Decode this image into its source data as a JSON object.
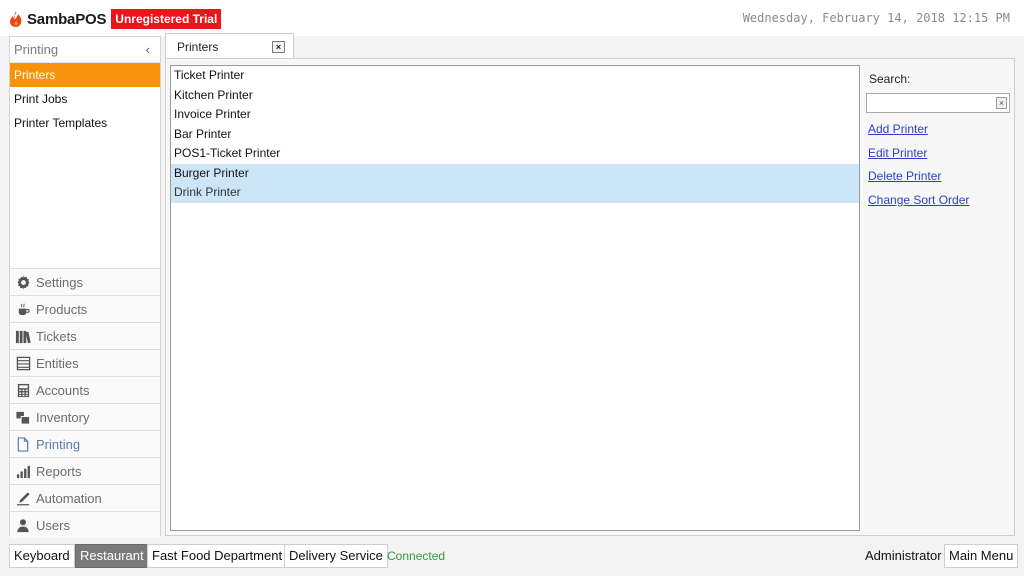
{
  "header": {
    "app_name": "SambaPOS",
    "trial_badge": "Unregistered Trial",
    "datetime": "Wednesday, February 14, 2018 12:15 PM"
  },
  "sidebar": {
    "section_title": "Printing",
    "collapse_glyph": "‹",
    "sub_items": [
      {
        "label": "Printers",
        "active": true
      },
      {
        "label": "Print Jobs",
        "active": false
      },
      {
        "label": "Printer Templates",
        "active": false
      }
    ],
    "nav_items": [
      {
        "label": "Settings",
        "icon": "gear-icon"
      },
      {
        "label": "Products",
        "icon": "coffee-cup-icon"
      },
      {
        "label": "Tickets",
        "icon": "books-icon"
      },
      {
        "label": "Entities",
        "icon": "table-icon"
      },
      {
        "label": "Accounts",
        "icon": "calculator-icon"
      },
      {
        "label": "Inventory",
        "icon": "boxes-icon"
      },
      {
        "label": "Printing",
        "icon": "document-icon"
      },
      {
        "label": "Reports",
        "icon": "bar-chart-icon"
      },
      {
        "label": "Automation",
        "icon": "pen-icon"
      },
      {
        "label": "Users",
        "icon": "user-icon"
      }
    ]
  },
  "tab": {
    "label": "Printers",
    "close_glyph": "×"
  },
  "printers": {
    "items": [
      {
        "name": "Ticket Printer",
        "selected": false
      },
      {
        "name": "Kitchen Printer",
        "selected": false
      },
      {
        "name": "Invoice Printer",
        "selected": false
      },
      {
        "name": "Bar Printer",
        "selected": false
      },
      {
        "name": "POS1-Ticket Printer",
        "selected": false
      },
      {
        "name": "Burger Printer",
        "selected": true
      },
      {
        "name": "Drink Printer",
        "selected": true
      }
    ]
  },
  "side": {
    "search_label": "Search:",
    "search_value": "",
    "clear_glyph": "×",
    "actions": [
      "Add Printer",
      "Edit Printer",
      "Delete Printer",
      "Change Sort Order"
    ]
  },
  "footer": {
    "keyboard": "Keyboard",
    "restaurant": "Restaurant",
    "fast_food": "Fast Food Department",
    "delivery": "Delivery Service",
    "status": "Connected",
    "user": "Administrator",
    "main_menu": "Main Menu"
  },
  "colors": {
    "accent": "#f7930a",
    "trial_red": "#e8171a",
    "selection": "#cde6f7",
    "link": "#2b3fc7",
    "status_green": "#2e9c3a"
  }
}
